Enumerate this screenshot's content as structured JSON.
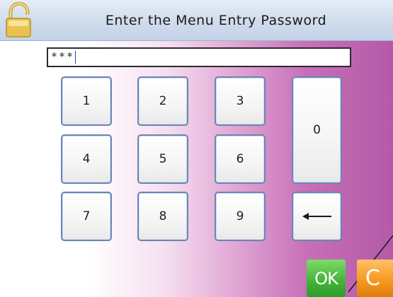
{
  "header": {
    "title": "Enter the Menu Entry Password",
    "icon": "lock-icon"
  },
  "password": {
    "value": "***"
  },
  "keypad": {
    "keys": [
      "1",
      "2",
      "3",
      "0",
      "4",
      "5",
      "6",
      "7",
      "8",
      "9"
    ],
    "backspace_icon": "arrow-left-icon"
  },
  "actions": {
    "ok_label": "OK",
    "clear_label": "C"
  },
  "colors": {
    "ok": "#46b63a",
    "clear": "#f59a22",
    "title_bar": "#cfdcec",
    "key_border": "#6b86b4"
  }
}
